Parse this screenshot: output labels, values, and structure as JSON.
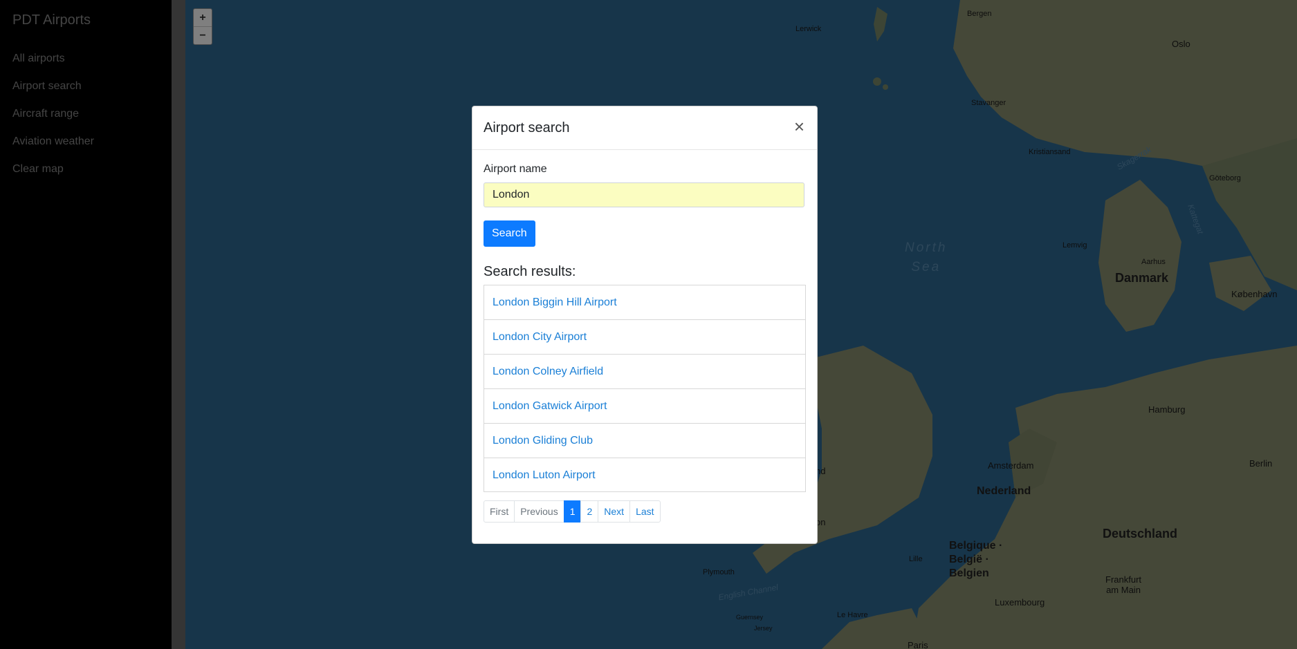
{
  "sidebar": {
    "brand": "PDT Airports",
    "items": [
      {
        "label": "All airports"
      },
      {
        "label": "Airport search"
      },
      {
        "label": "Aircraft range"
      },
      {
        "label": "Aviation weather"
      },
      {
        "label": "Clear map"
      }
    ]
  },
  "map": {
    "zoom_in": "+",
    "zoom_out": "−",
    "labels": {
      "bergen": "Bergen",
      "lerwick": "Lerwick",
      "oslo": "Oslo",
      "stavanger": "Stavanger",
      "kristiansand": "Kristiansand",
      "skagerrak": "Skagerrak",
      "goteborg": "Göteborg",
      "kattegat": "Kattegat",
      "north_sea": "North\nSea",
      "lemvig": "Lemvig",
      "aarhus": "Aarhus",
      "danmark": "Danmark",
      "kobenhavn": "København",
      "hamburg": "Hamburg",
      "amsterdam": "Amsterdam",
      "nederland": "Nederland",
      "berlin": "Berlin",
      "deutschland": "Deutschland",
      "belgique": "Belgique ·\nBelgië ·\nBelgien",
      "lille": "Lille",
      "frankfurt": "Frankfurt\nam Main",
      "luxembourg": "Luxembourg",
      "plymouth": "Plymouth",
      "english_channel": "English Channel",
      "guernsey": "Guernsey",
      "jersey": "Jersey",
      "le_havre": "Le Havre",
      "paris": "Paris",
      "england_partial": "nd",
      "london_partial": "on"
    }
  },
  "modal": {
    "title": "Airport search",
    "close": "×",
    "field_label": "Airport name",
    "field_value": "London",
    "search_button": "Search",
    "results_heading": "Search results:",
    "results": [
      "London Biggin Hill Airport",
      "London City Airport",
      "London Colney Airfield",
      "London Gatwick Airport",
      "London Gliding Club",
      "London Luton Airport"
    ],
    "pagination": {
      "first": "First",
      "previous": "Previous",
      "pages": [
        "1",
        "2"
      ],
      "current": "1",
      "next": "Next",
      "last": "Last"
    }
  }
}
